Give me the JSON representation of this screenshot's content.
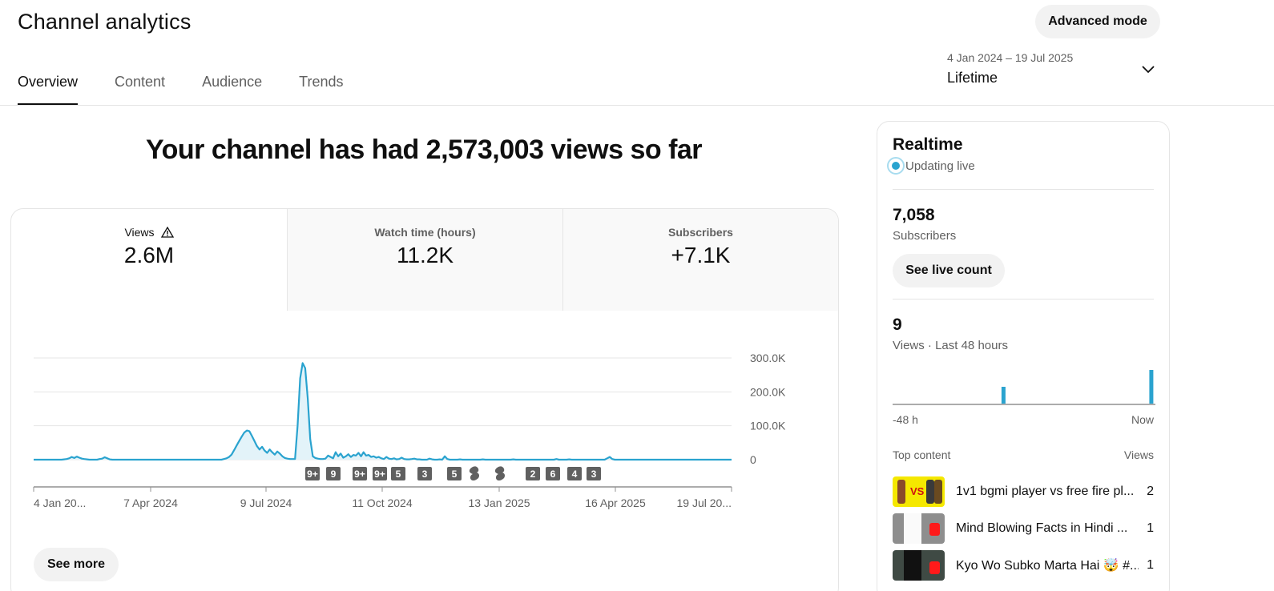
{
  "header": {
    "title": "Channel analytics",
    "advanced_mode_label": "Advanced mode"
  },
  "tabs": [
    {
      "label": "Overview",
      "active": true
    },
    {
      "label": "Content",
      "active": false
    },
    {
      "label": "Audience",
      "active": false
    },
    {
      "label": "Trends",
      "active": false
    }
  ],
  "date_picker": {
    "range": "4 Jan 2024 – 19 Jul 2025",
    "label": "Lifetime",
    "icon": "chevron-down-icon"
  },
  "headline": "Your channel has had 2,573,003 views so far",
  "metrics": [
    {
      "label": "Views",
      "value": "2.6M",
      "icon": "warning-icon",
      "selected": true
    },
    {
      "label": "Watch time (hours)",
      "value": "11.2K",
      "selected": false
    },
    {
      "label": "Subscribers",
      "value": "+7.1K",
      "selected": false
    }
  ],
  "see_more_label": "See more",
  "colors": {
    "accent_line": "#2aa3cf",
    "grid": "#e5e5e5",
    "badge": "#606060"
  },
  "chart_data": {
    "type": "area",
    "series": [
      {
        "values": [
          0,
          0,
          0,
          0,
          0,
          0,
          0,
          0,
          0,
          0,
          0,
          0,
          1000,
          2000,
          4000,
          8000,
          5000,
          9000,
          6000,
          3000,
          2000,
          1000,
          0,
          0,
          0,
          0,
          2000,
          3000,
          7000,
          4000,
          1000,
          0,
          0,
          0,
          0,
          0,
          0,
          0,
          0,
          0,
          0,
          0,
          0,
          0,
          0,
          0,
          0,
          0,
          0,
          0,
          0,
          0,
          0,
          0,
          0,
          0,
          0,
          0,
          0,
          0,
          0,
          0,
          0,
          0,
          0,
          0,
          0,
          0,
          0,
          0,
          0,
          0,
          0,
          0,
          0,
          2000,
          4000,
          8000,
          15000,
          28000,
          42000,
          55000,
          68000,
          80000,
          86000,
          84000,
          70000,
          55000,
          40000,
          30000,
          38000,
          27000,
          20000,
          30000,
          22000,
          15000,
          24000,
          18000,
          10000,
          5000,
          3000,
          2000,
          2000,
          2000,
          100000,
          240000,
          285000,
          270000,
          180000,
          60000,
          10000,
          5000,
          3000,
          2000,
          2000,
          3000,
          12000,
          8000,
          4000,
          22000,
          10000,
          18000,
          6000,
          10000,
          16000,
          8000,
          14000,
          12000,
          20000,
          10000,
          22000,
          12000,
          14000,
          8000,
          10000,
          6000,
          8000,
          4000,
          2000,
          8000,
          3000,
          2000,
          4000,
          1000,
          2000,
          6000,
          2000,
          1000,
          1000,
          2000,
          3000,
          1000,
          1000,
          0,
          0,
          0,
          3000,
          1000,
          0,
          0,
          1000,
          0,
          10000,
          2000,
          0,
          0,
          0,
          0,
          1000,
          0,
          0,
          0,
          0,
          0,
          0,
          0,
          0,
          1000,
          0,
          0,
          0,
          0,
          0,
          0,
          0,
          0,
          0,
          0,
          0,
          1000,
          0,
          0,
          0,
          0,
          0,
          0,
          0,
          0,
          0,
          0,
          0,
          0,
          0,
          0,
          0,
          0,
          2000,
          0,
          0,
          0,
          0,
          1000,
          0,
          0,
          0,
          0,
          0,
          0,
          0,
          0,
          0,
          0,
          0,
          0,
          0,
          0,
          4000,
          8000,
          2000,
          0,
          0,
          0,
          0,
          0,
          0,
          0,
          0,
          0,
          0,
          0,
          0,
          0,
          0,
          0,
          0,
          0,
          0,
          0,
          0,
          0,
          0,
          0,
          0,
          0,
          0,
          0,
          0,
          0,
          0,
          0,
          0,
          0,
          0,
          0,
          0,
          0,
          0,
          0,
          0,
          0,
          0,
          0,
          0,
          0,
          0,
          0
        ]
      }
    ],
    "yticks": [
      0,
      100000,
      200000,
      300000
    ],
    "ytick_labels": [
      "0",
      "100.0K",
      "200.0K",
      "300.0K"
    ],
    "ylim": [
      0,
      300000
    ],
    "xtick_labels": [
      "4 Jan 20...",
      "7 Apr 2024",
      "9 Jul 2024",
      "11 Oct 2024",
      "13 Jan 2025",
      "16 Apr 2025",
      "19 Jul 20..."
    ],
    "grid": true,
    "badges": [
      {
        "label": "9+",
        "type": "count"
      },
      {
        "label": "9",
        "type": "count"
      },
      {
        "label": "9+",
        "type": "count"
      },
      {
        "label": "9+",
        "type": "count"
      },
      {
        "label": "5",
        "type": "count"
      },
      {
        "label": "3",
        "type": "count"
      },
      {
        "label": "5",
        "type": "count"
      },
      {
        "label": "",
        "type": "shorts"
      },
      {
        "label": "",
        "type": "shorts"
      },
      {
        "label": "2",
        "type": "count"
      },
      {
        "label": "6",
        "type": "count"
      },
      {
        "label": "4",
        "type": "count"
      },
      {
        "label": "3",
        "type": "count"
      }
    ]
  },
  "realtime": {
    "title": "Realtime",
    "live_label": "Updating live",
    "subscribers_value": "7,058",
    "subscribers_label": "Subscribers",
    "live_count_label": "See live count",
    "views_value": "9",
    "views_label": "Views · Last 48 hours",
    "axis_start": "-48 h",
    "axis_end": "Now",
    "mini_bars": [
      0,
      0,
      0,
      0,
      0,
      0,
      0,
      0,
      0,
      0,
      0,
      0,
      0,
      0,
      0,
      0,
      0,
      0,
      0,
      0,
      0,
      0,
      0,
      0,
      0,
      0,
      0,
      0,
      0,
      0,
      0,
      0,
      0,
      0,
      0,
      0,
      0,
      0,
      0,
      0,
      1,
      0,
      0,
      0,
      0,
      0,
      0,
      0,
      0,
      0,
      0,
      0,
      0,
      0,
      0,
      0,
      0,
      0,
      0,
      0,
      0,
      0,
      0,
      0,
      0,
      0,
      0,
      0,
      0,
      0,
      0,
      0,
      0,
      0,
      0,
      0,
      0,
      0,
      0,
      0,
      0,
      0,
      0,
      0,
      0,
      0,
      0,
      0,
      0,
      0,
      0,
      0,
      0,
      0,
      2,
      0
    ],
    "top_content_label": "Top content",
    "top_views_label": "Views",
    "top_content": [
      {
        "title": "1v1 bgmi player vs free fire pl...",
        "views": "2"
      },
      {
        "title": "Mind Blowing Facts in Hindi ...",
        "views": "1"
      },
      {
        "title": "Kyo Wo Subko Marta Hai 🤯 #...",
        "views": "1"
      }
    ]
  }
}
